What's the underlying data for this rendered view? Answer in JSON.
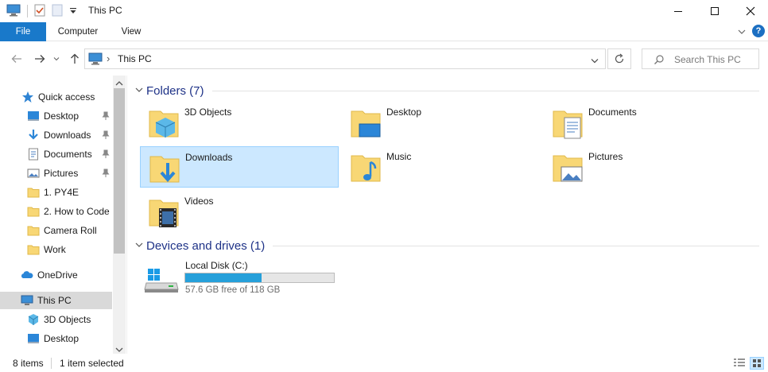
{
  "window": {
    "title": "This PC"
  },
  "ribbon": {
    "tabs": [
      "File",
      "Computer",
      "View"
    ]
  },
  "address": {
    "path_label": "This PC",
    "separator": "›"
  },
  "search": {
    "placeholder": "Search This PC"
  },
  "nav": {
    "items": [
      {
        "label": "Quick access",
        "icon": "star-icon",
        "pinned": false
      },
      {
        "label": "Desktop",
        "icon": "desktop-icon",
        "pinned": true
      },
      {
        "label": "Downloads",
        "icon": "download-icon",
        "pinned": true
      },
      {
        "label": "Documents",
        "icon": "document-icon",
        "pinned": true
      },
      {
        "label": "Pictures",
        "icon": "pictures-icon",
        "pinned": true
      },
      {
        "label": "1. PY4E",
        "icon": "folder-icon",
        "pinned": false
      },
      {
        "label": "2. How to Code",
        "icon": "folder-icon",
        "pinned": false
      },
      {
        "label": "Camera Roll",
        "icon": "folder-icon",
        "pinned": false
      },
      {
        "label": "Work",
        "icon": "folder-icon",
        "pinned": false
      },
      {
        "label": "OneDrive",
        "icon": "cloud-icon",
        "pinned": false
      },
      {
        "label": "This PC",
        "icon": "pc-icon",
        "pinned": false
      },
      {
        "label": "3D Objects",
        "icon": "cube-icon",
        "pinned": false
      },
      {
        "label": "Desktop",
        "icon": "desktop-icon",
        "pinned": false
      }
    ]
  },
  "folders": {
    "header": "Folders (7)",
    "items": [
      {
        "label": "3D Objects",
        "icon": "3d-objects-folder-icon"
      },
      {
        "label": "Desktop",
        "icon": "desktop-folder-icon"
      },
      {
        "label": "Documents",
        "icon": "documents-folder-icon"
      },
      {
        "label": "Downloads",
        "icon": "downloads-folder-icon",
        "selected": true
      },
      {
        "label": "Music",
        "icon": "music-folder-icon"
      },
      {
        "label": "Pictures",
        "icon": "pictures-folder-icon"
      },
      {
        "label": "Videos",
        "icon": "videos-folder-icon"
      }
    ]
  },
  "drives": {
    "header": "Devices and drives (1)",
    "items": [
      {
        "label": "Local Disk (C:)",
        "free_text": "57.6 GB free of 118 GB",
        "used_fraction": 0.512,
        "icon": "drive-icon"
      }
    ]
  },
  "status": {
    "count": "8 items",
    "selection": "1 item selected"
  },
  "colors": {
    "accent": "#1979ca",
    "selection": "#cce8ff",
    "drive_fill": "#26a0da",
    "folder": "#f8d775"
  }
}
